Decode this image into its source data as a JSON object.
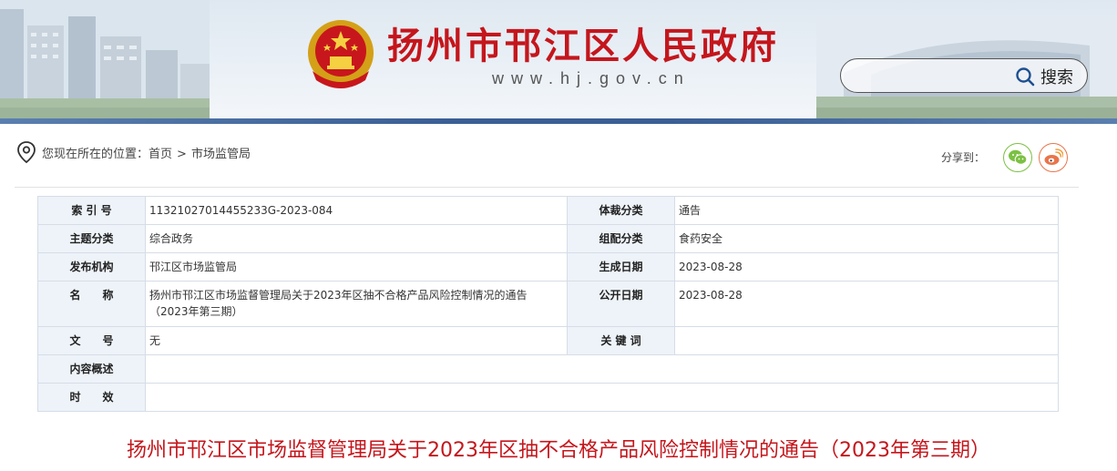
{
  "header": {
    "site_title": "扬州市邗江区人民政府",
    "site_url": "www.hj.gov.cn",
    "search_placeholder": "",
    "search_label": "搜索"
  },
  "breadcrumb": {
    "prefix": "您现在所在的位置：",
    "home": "首页",
    "separator": ">",
    "current": "市场监管局"
  },
  "share": {
    "label": "分享到：",
    "targets": [
      "wechat-icon",
      "weibo-icon"
    ]
  },
  "info": {
    "index_label": "索 引 号",
    "index_value": "11321027014455233G-2023-084",
    "genre_label": "体裁分类",
    "genre_value": "通告",
    "topic_label": "主题分类",
    "topic_value": "综合政务",
    "org_cat_label": "组配分类",
    "org_cat_value": "食药安全",
    "publisher_label": "发布机构",
    "publisher_value": "邗江区市场监管局",
    "created_label": "生成日期",
    "created_value": "2023-08-28",
    "name_label": "名　　称",
    "name_value": "扬州市邗江区市场监督管理局关于2023年区抽不合格产品风险控制情况的通告（2023年第三期）",
    "public_label": "公开日期",
    "public_value": "2023-08-28",
    "docno_label": "文　　号",
    "docno_value": "无",
    "keywords_label": "关 键 词",
    "keywords_value": "",
    "summary_label": "内容概述",
    "summary_value": "",
    "validity_label": "时　　效",
    "validity_value": ""
  },
  "article": {
    "title": "扬州市邗江区市场监督管理局关于2023年区抽不合格产品风险控制情况的通告（2023年第三期）"
  },
  "colors": {
    "brand_red": "#c4161c",
    "label_bg": "#eef3f9",
    "border": "#d6dde6",
    "wechat_green": "#7bc142",
    "weibo_orange": "#e9744a"
  }
}
